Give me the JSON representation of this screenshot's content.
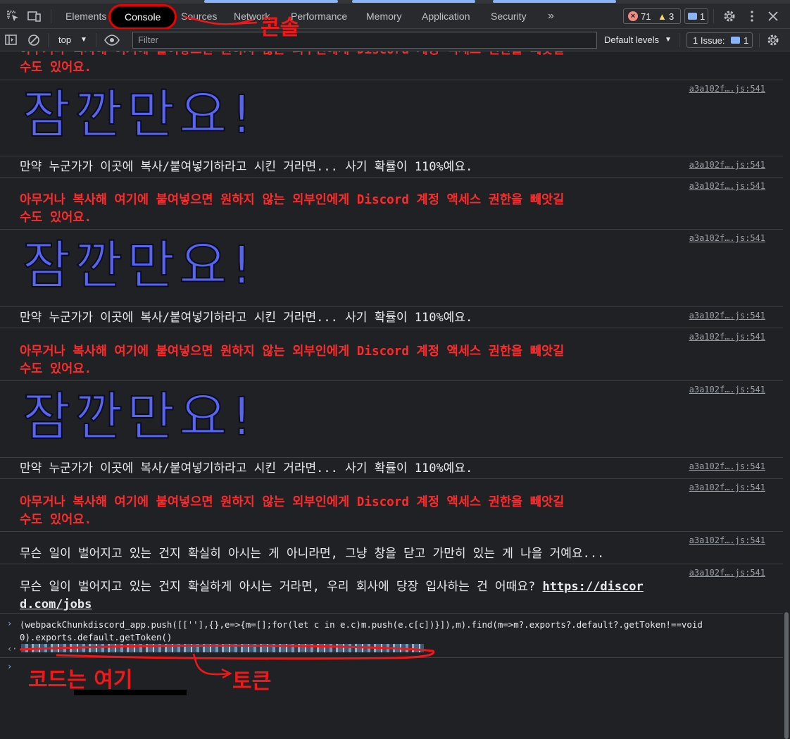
{
  "tabs": [
    {
      "label": "Elements"
    },
    {
      "label": "Console"
    },
    {
      "label": "Sources"
    },
    {
      "label": "Network"
    },
    {
      "label": "Performance"
    },
    {
      "label": "Memory"
    },
    {
      "label": "Application"
    },
    {
      "label": "Security"
    }
  ],
  "status": {
    "errors": "71",
    "warnings": "3",
    "messages": "1"
  },
  "toolbar": {
    "context": "top",
    "filter_placeholder": "Filter",
    "levels": "Default levels",
    "issues": "1 Issue:",
    "issues_count": "1"
  },
  "console": {
    "source": "a3a102f….js:541",
    "top_cut": "아무거나 복사해 여기에 붙여넣으면 원하지 않는 외부인에게 Discord 계정 액세스 권한을 빼앗길",
    "top_cut2": "수도 있어요.",
    "big": "잠깐만요!",
    "scam_line": "만약 누군가가 이곳에 복사/붙여넣기하라고 시킨 거라면... 사기 확률이 110%예요.",
    "warn_line1": "아무거나 복사해 여기에 붙여넣으면 원하지 않는 외부인에게 Discord 계정 액세스 권한을 빼앗길",
    "warn_line2": "수도 있어요.",
    "close_line": "무슨 일이 벌어지고 있는 건지 확실히 아시는 게 아니라면, 그냥 창을 닫고 가만히 있는 게 나을 거예요...",
    "jobs_line": "무슨 일이 벌어지고 있는 건지 확실하게 아시는 거라면, 우리 회사에 당장 입사하는 건 어때요?",
    "jobs_link_a": "https://discor",
    "jobs_link_b": "d.com/jobs",
    "cmd_line1": "(webpackChunkdiscord_app.push([[''],{},e=>{m=[];for(let c in e.c)m.push(e.c[c])}]),m).find(m=>m?.exports?.default?.getToken!==void",
    "cmd_line2": "0).exports.default.getToken()"
  },
  "annotations": {
    "console_label": "콘솔",
    "code_label": "코드는 여기",
    "token_label": "토큰"
  },
  "colors": {
    "warn_red": "#ff2a2a",
    "blurple": "#5865f2",
    "annot_red": "#f01818"
  }
}
